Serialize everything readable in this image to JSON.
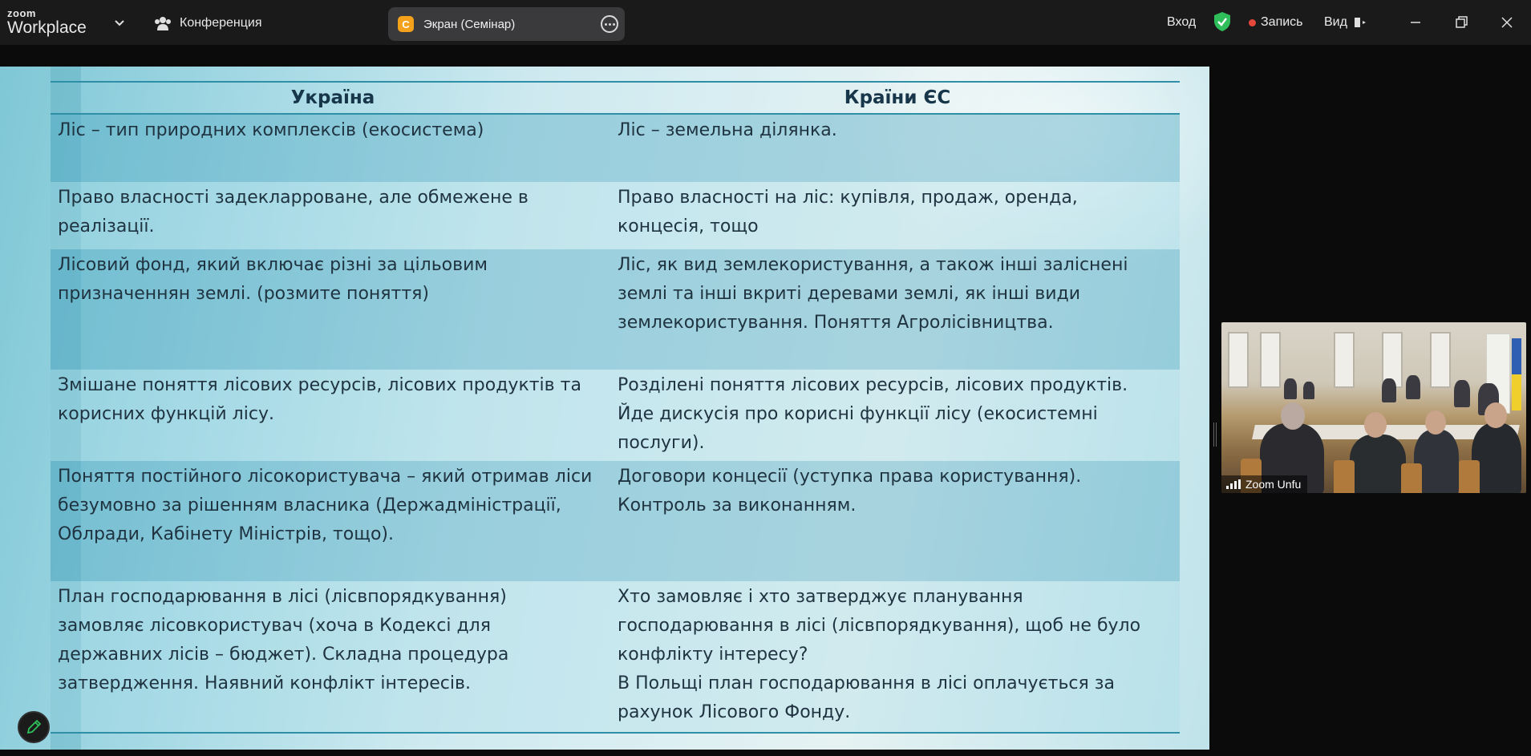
{
  "app": {
    "logo_small": "zoom",
    "logo_big": "Workplace"
  },
  "header": {
    "meeting_label": "Конференция",
    "share_label": "Экран (Семінар)",
    "share_app_letter": "C",
    "login_label": "Вход",
    "record_label": "Запись",
    "view_label": "Вид"
  },
  "colors": {
    "accent_green": "#2fbf5a",
    "record_red": "#e5483b",
    "share_app_icon": "#f4a21b"
  },
  "slide": {
    "columns": [
      "Україна",
      "Країни ЄС"
    ],
    "rows": [
      {
        "ua": [
          "Ліс – тип природних комплексів (екосистема)"
        ],
        "eu": [
          "Ліс – земельна ділянка."
        ]
      },
      {
        "ua": [
          "Право власності задекларроване, але обмежене в",
          "реалізації."
        ],
        "eu": [
          "Право власності на ліс: купівля, продаж, оренда,",
          "концесія, тощо"
        ]
      },
      {
        "ua": [
          "Лісовий фонд, який включає різні за цільовим",
          "призначеннян землі. (розмите поняття)"
        ],
        "eu": [
          "Ліс, як вид землекористування, а також інші заліснені",
          "землі та інші вкриті деревами землі, як інші види",
          "землекористування. Поняття Агролісівництва."
        ]
      },
      {
        "ua": [
          "Змішане поняття лісових ресурсів, лісових продуктів та",
          "корисних функцій лісу."
        ],
        "eu": [
          "Розділені поняття лісових ресурсів, лісових продуктів.",
          "Йде дискусія про корисні функції лісу (екосистемні",
          "послуги)."
        ]
      },
      {
        "ua": [
          "Поняття постійного лісокористувача – який отримав ліси",
          "безумовно за рішенням власника (Держадміністрації,",
          "Облради, Кабінету Міністрів, тощо)."
        ],
        "eu": [
          "Договори концесії (уступка права користування).",
          "Контроль за виконанням."
        ]
      },
      {
        "ua": [
          "План господарювання в лісі (лісвпорядкування)",
          "замовляє лісовкористувач (хоча в Кодексі для",
          "державних лісів – бюджет). Складна процедура",
          "затвердження. Наявний конфлікт інтересів."
        ],
        "eu": [
          "Хто замовляє і хто затверджує планування",
          "господарювання в лісі (лісвпорядкування), щоб не було",
          "конфлікту інтересу?",
          "В Польщі план господарювання в лісі оплачується за",
          "рахунок Лісового Фонду."
        ]
      }
    ]
  },
  "video": {
    "participant_name": "Zoom Unfu"
  },
  "icons": {
    "chevron": "chevron-down-icon",
    "participants": "participants-icon",
    "more": "more-options-icon",
    "shield": "shield-check-icon",
    "record": "record-dot-icon",
    "view": "view-layout-icon",
    "minimize": "minimize-icon",
    "restore": "restore-icon",
    "close": "close-icon",
    "annotate": "pencil-icon",
    "signal": "signal-bars-icon"
  }
}
